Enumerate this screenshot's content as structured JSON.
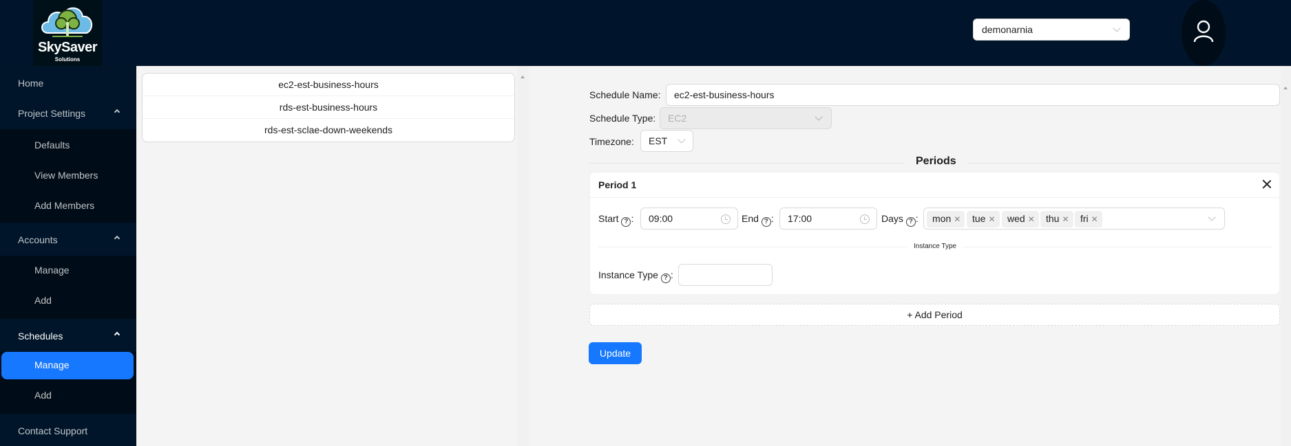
{
  "header": {
    "logo": {
      "name": "SkySaver",
      "subtitle": "Solutions"
    },
    "project_select": {
      "value": "demonarnia"
    },
    "user_icon": "user-icon"
  },
  "sidebar": {
    "items": [
      {
        "label": "Home"
      },
      {
        "label": "Project Settings",
        "expanded": true,
        "children": [
          {
            "label": "Defaults"
          },
          {
            "label": "View Members"
          },
          {
            "label": "Add Members"
          }
        ]
      },
      {
        "label": "Accounts",
        "expanded": true,
        "children": [
          {
            "label": "Manage"
          },
          {
            "label": "Add"
          }
        ]
      },
      {
        "label": "Schedules",
        "expanded": true,
        "children": [
          {
            "label": "Manage",
            "selected": true
          },
          {
            "label": "Add"
          }
        ]
      },
      {
        "label": "Contact Support"
      }
    ]
  },
  "schedule_list": [
    "ec2-est-business-hours",
    "rds-est-business-hours",
    "rds-est-sclae-down-weekends"
  ],
  "form": {
    "schedule_name": {
      "label": "Schedule Name",
      "value": "ec2-est-business-hours"
    },
    "schedule_type": {
      "label": "Schedule Type",
      "value": "EC2",
      "disabled": true
    },
    "timezone": {
      "label": "Timezone",
      "value": "EST"
    },
    "periods_heading": "Periods",
    "periods": [
      {
        "title": "Period 1",
        "start": {
          "label": "Start",
          "value": "09:00"
        },
        "end": {
          "label": "End",
          "value": "17:00"
        },
        "days": {
          "label": "Days",
          "values": [
            "mon",
            "tue",
            "wed",
            "thu",
            "fri"
          ]
        },
        "instance_type_heading": "Instance Type",
        "instance_type": {
          "label": "Instance Type",
          "value": ""
        }
      }
    ],
    "add_period_label": "+ Add Period",
    "update_label": "Update"
  },
  "colors": {
    "header_bg": "#00152b",
    "sidebar_bg": "#001529",
    "submenu_bg": "#000c17",
    "primary": "#1677ff",
    "content_bg": "#f4f4f4"
  }
}
